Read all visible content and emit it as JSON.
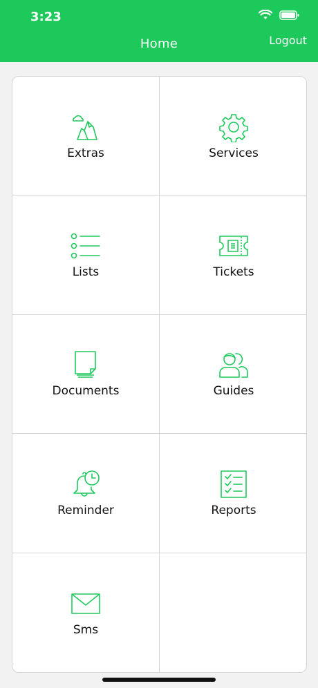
{
  "status_bar": {
    "time": "3:23"
  },
  "header": {
    "title": "Home",
    "logout_label": "Logout"
  },
  "menu": {
    "items": [
      {
        "label": "Extras",
        "icon": "landscape-icon"
      },
      {
        "label": "Services",
        "icon": "gear-icon"
      },
      {
        "label": "Lists",
        "icon": "list-icon"
      },
      {
        "label": "Tickets",
        "icon": "ticket-icon"
      },
      {
        "label": "Documents",
        "icon": "document-icon"
      },
      {
        "label": "Guides",
        "icon": "people-icon"
      },
      {
        "label": "Reminder",
        "icon": "bell-clock-icon"
      },
      {
        "label": "Reports",
        "icon": "checklist-icon"
      },
      {
        "label": "Sms",
        "icon": "envelope-icon"
      }
    ]
  },
  "colors": {
    "brand_green": "#1ec95b",
    "background": "#f2f2f2"
  }
}
